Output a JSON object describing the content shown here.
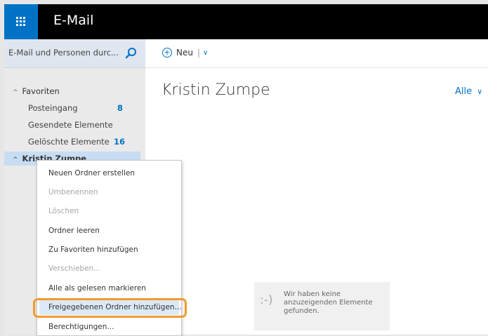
{
  "header": {
    "app_title": "E-Mail"
  },
  "search": {
    "placeholder": "E-Mail und Personen durc..."
  },
  "toolbar": {
    "new_label": "Neu",
    "separator": "|"
  },
  "sidebar": {
    "favorites_label": "Favoriten",
    "favorites": [
      {
        "label": "Posteingang",
        "count": "8"
      },
      {
        "label": "Gesendete Elemente",
        "count": ""
      },
      {
        "label": "Gelöschte Elemente",
        "count": "16"
      }
    ],
    "account_label": "Kristin Zumpe"
  },
  "main": {
    "folder_title": "Kristin Zumpe",
    "filter_label": "Alle",
    "empty_face": ":-)",
    "empty_message": "Wir haben keine anzuzeigenden Elemente gefunden."
  },
  "context_menu": {
    "items": [
      {
        "label": "Neuen Ordner erstellen",
        "enabled": true
      },
      {
        "label": "Umbenennen",
        "enabled": false
      },
      {
        "label": "Löschen",
        "enabled": false
      },
      {
        "label": "Ordner leeren",
        "enabled": true
      },
      {
        "label": "Zu Favoriten hinzufügen",
        "enabled": true
      },
      {
        "label": "Verschieben...",
        "enabled": false
      },
      {
        "label": "Alle als gelesen markieren",
        "enabled": true
      },
      {
        "label": "Freigegebenen Ordner hinzufügen...",
        "enabled": true
      },
      {
        "label": "Berechtigungen...",
        "enabled": true
      }
    ]
  },
  "colors": {
    "accent": "#0072c6",
    "highlight_ring": "#f29a2e",
    "selection": "#c7ddf3"
  },
  "icons": {
    "app_launcher": "waffle-icon",
    "search": "search-icon",
    "new": "plus-circle-icon"
  }
}
